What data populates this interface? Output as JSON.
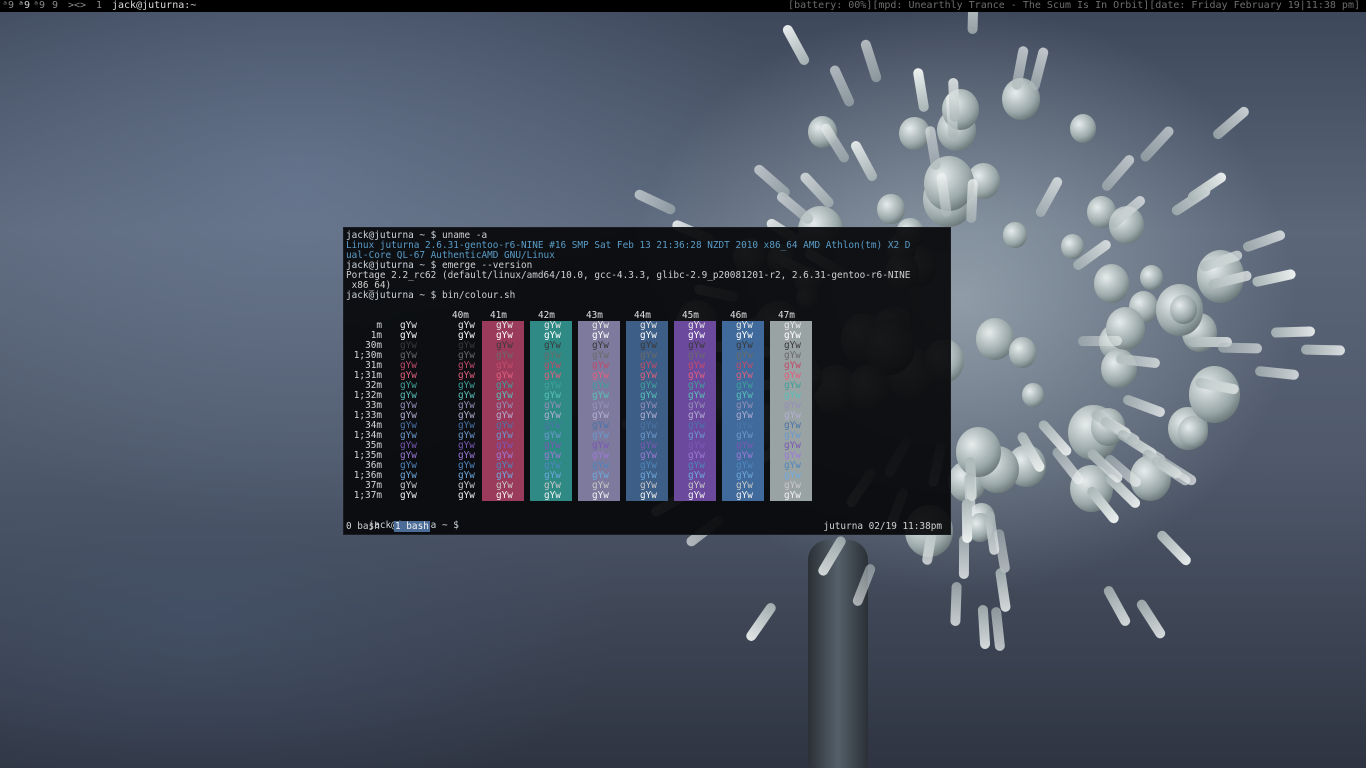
{
  "topbar": {
    "workspaces": [
      {
        "label": "ᵃ9",
        "active": false
      },
      {
        "label": "ᵃ9",
        "active": true
      },
      {
        "label": "ᵃ9",
        "active": false
      },
      {
        "label": "9",
        "active": false
      },
      {
        "label": "><>",
        "active": false
      },
      {
        "label": "1",
        "active": false
      }
    ],
    "window_title": "jack@juturna:~",
    "status": "[battery: 00%][mpd: Unearthly Trance - The Scum Is In Orbit][date: Friday February 19|11:38 pm]"
  },
  "terminal": {
    "lines": [
      {
        "segments": [
          {
            "text": "jack@juturna ~ $ ",
            "style": "user"
          },
          {
            "text": "uname -a",
            "style": "plain"
          }
        ]
      },
      {
        "segments": [
          {
            "text": "Linux juturna 2.6.31-gentoo-r6-NINE #16 SMP Sat Feb 13 21:36:28 NZDT 2010 x86_64 AMD Athlon(tm) X2 D",
            "style": "cyan"
          }
        ]
      },
      {
        "segments": [
          {
            "text": "ual-Core QL-67 AuthenticAMD GNU/Linux",
            "style": "cyan"
          }
        ]
      },
      {
        "segments": [
          {
            "text": "jack@juturna ~ $ ",
            "style": "user"
          },
          {
            "text": "emerge --version",
            "style": "plain"
          }
        ]
      },
      {
        "segments": [
          {
            "text": "Portage 2.2_rc62 (default/linux/amd64/10.0, gcc-4.3.3, glibc-2.9_p20081201-r2, 2.6.31-gentoo-r6-NINE",
            "style": "plain"
          }
        ]
      },
      {
        "segments": [
          {
            "text": " x86_64)",
            "style": "plain"
          }
        ]
      },
      {
        "segments": [
          {
            "text": "jack@juturna ~ $ ",
            "style": "user"
          },
          {
            "text": "bin/colour.sh",
            "style": "plain"
          }
        ]
      }
    ],
    "colour_table": {
      "headers": [
        "40m",
        "41m",
        "42m",
        "43m",
        "44m",
        "45m",
        "46m",
        "47m"
      ],
      "header_bgs": [
        "transparent",
        "#9b3b5b",
        "#2f8a86",
        "#7d7a9d",
        "#3d5e86",
        "#6b4a9e",
        "#3f6a9b",
        "#9aa3a4"
      ],
      "row_labels": [
        "m",
        "1m",
        "30m",
        "1;30m",
        "31m",
        "1;31m",
        "32m",
        "1;32m",
        "33m",
        "1;33m",
        "34m",
        "1;34m",
        "35m",
        "1;35m",
        "36m",
        "1;36m",
        "37m",
        "1;37m"
      ],
      "row_colors": [
        "#e8e8e8",
        "#ffffff",
        "#3a3a3a",
        "#6a6a6a",
        "#c24b6a",
        "#e0607e",
        "#3fa09a",
        "#58c0b8",
        "#9490b8",
        "#b3aed2",
        "#4a74a8",
        "#6b98cc",
        "#7a58b4",
        "#9c7ad6",
        "#4f86bd",
        "#6fa8dc",
        "#c8c8c8",
        "#f2f2f2"
      ],
      "sample": "gYw"
    },
    "prompt": "jack@juturna ~ $ "
  },
  "tmux": {
    "tab0": "0 bash",
    "tab1": "1 bash",
    "right": "juturna  02/19 11:38pm"
  }
}
